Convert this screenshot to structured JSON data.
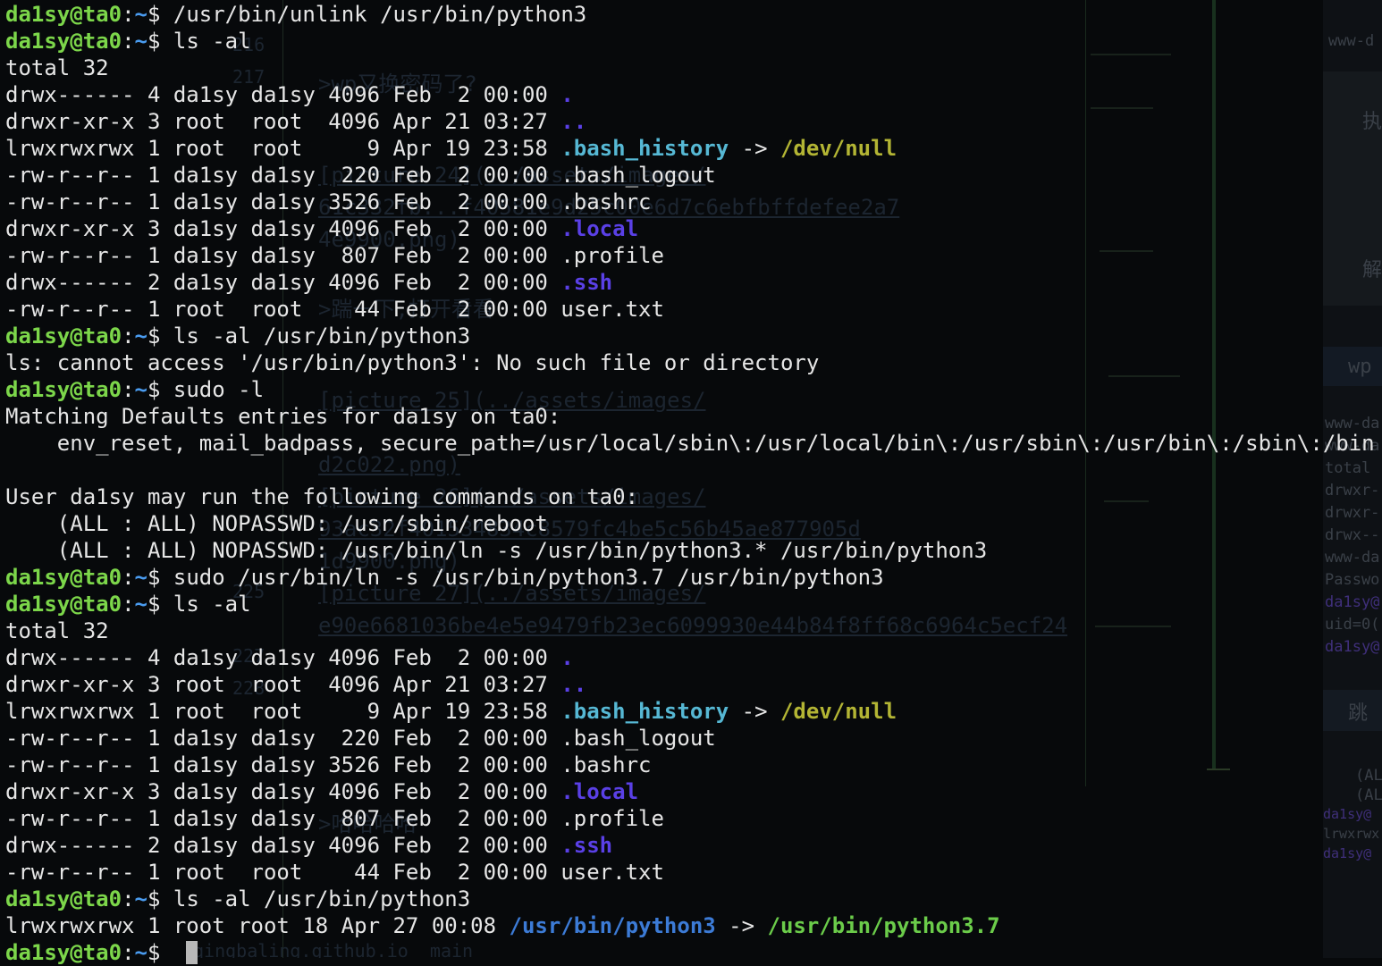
{
  "prompt": {
    "user": "da1sy",
    "at": "@",
    "host": "ta0",
    "colon": ":",
    "path": "~",
    "symbol": "$ "
  },
  "lines": [
    {
      "type": "prompt",
      "cmd": "/usr/bin/unlink /usr/bin/python3"
    },
    {
      "type": "prompt",
      "cmd": "ls -al"
    },
    {
      "type": "text",
      "text": "total 32"
    },
    {
      "type": "ls",
      "prefix": "drwx------ 4 da1sy da1sy 4096 Feb  2 00:00 ",
      "name": ".",
      "style": "dir"
    },
    {
      "type": "ls",
      "prefix": "drwxr-xr-x 3 root  root  4096 Apr 21 03:27 ",
      "name": "..",
      "style": "dir"
    },
    {
      "type": "ls",
      "prefix": "lrwxrwxrwx 1 root  root     9 Apr 19 23:58 ",
      "name": ".bash_history",
      "style": "cyan",
      "arrow": " -> ",
      "target": "/dev/null",
      "targetStyle": "yellow"
    },
    {
      "type": "ls",
      "prefix": "-rw-r--r-- 1 da1sy da1sy  220 Feb  2 00:00 ",
      "name": ".bash_logout",
      "style": "plain"
    },
    {
      "type": "ls",
      "prefix": "-rw-r--r-- 1 da1sy da1sy 3526 Feb  2 00:00 ",
      "name": ".bashrc",
      "style": "plain"
    },
    {
      "type": "ls",
      "prefix": "drwxr-xr-x 3 da1sy da1sy 4096 Feb  2 00:00 ",
      "name": ".local",
      "style": "dir"
    },
    {
      "type": "ls",
      "prefix": "-rw-r--r-- 1 da1sy da1sy  807 Feb  2 00:00 ",
      "name": ".profile",
      "style": "plain"
    },
    {
      "type": "ls",
      "prefix": "drwx------ 2 da1sy da1sy 4096 Feb  2 00:00 ",
      "name": ".ssh",
      "style": "dir"
    },
    {
      "type": "ls",
      "prefix": "-rw-r--r-- 1 root  root    44 Feb  2 00:00 ",
      "name": "user.txt",
      "style": "plain"
    },
    {
      "type": "prompt",
      "cmd": "ls -al /usr/bin/python3"
    },
    {
      "type": "text",
      "text": "ls: cannot access '/usr/bin/python3': No such file or directory"
    },
    {
      "type": "prompt",
      "cmd": "sudo -l"
    },
    {
      "type": "text",
      "text": "Matching Defaults entries for da1sy on ta0:"
    },
    {
      "type": "text",
      "text": "    env_reset, mail_badpass, secure_path=/usr/local/sbin\\:/usr/local/bin\\:/usr/sbin\\:/usr/bin\\:/sbin\\:/bin"
    },
    {
      "type": "text",
      "text": ""
    },
    {
      "type": "text",
      "text": "User da1sy may run the following commands on ta0:"
    },
    {
      "type": "text",
      "text": "    (ALL : ALL) NOPASSWD: /usr/sbin/reboot"
    },
    {
      "type": "text",
      "text": "    (ALL : ALL) NOPASSWD: /usr/bin/ln -s /usr/bin/python3.* /usr/bin/python3"
    },
    {
      "type": "prompt",
      "cmd": "sudo /usr/bin/ln -s /usr/bin/python3.7 /usr/bin/python3"
    },
    {
      "type": "prompt",
      "cmd": "ls -al"
    },
    {
      "type": "text",
      "text": "total 32"
    },
    {
      "type": "ls",
      "prefix": "drwx------ 4 da1sy da1sy 4096 Feb  2 00:00 ",
      "name": ".",
      "style": "dir"
    },
    {
      "type": "ls",
      "prefix": "drwxr-xr-x 3 root  root  4096 Apr 21 03:27 ",
      "name": "..",
      "style": "dir"
    },
    {
      "type": "ls",
      "prefix": "lrwxrwxrwx 1 root  root     9 Apr 19 23:58 ",
      "name": ".bash_history",
      "style": "cyan",
      "arrow": " -> ",
      "target": "/dev/null",
      "targetStyle": "yellow"
    },
    {
      "type": "ls",
      "prefix": "-rw-r--r-- 1 da1sy da1sy  220 Feb  2 00:00 ",
      "name": ".bash_logout",
      "style": "plain"
    },
    {
      "type": "ls",
      "prefix": "-rw-r--r-- 1 da1sy da1sy 3526 Feb  2 00:00 ",
      "name": ".bashrc",
      "style": "plain"
    },
    {
      "type": "ls",
      "prefix": "drwxr-xr-x 3 da1sy da1sy 4096 Feb  2 00:00 ",
      "name": ".local",
      "style": "dir"
    },
    {
      "type": "ls",
      "prefix": "-rw-r--r-- 1 da1sy da1sy  807 Feb  2 00:00 ",
      "name": ".profile",
      "style": "plain"
    },
    {
      "type": "ls",
      "prefix": "drwx------ 2 da1sy da1sy 4096 Feb  2 00:00 ",
      "name": ".ssh",
      "style": "dir"
    },
    {
      "type": "ls",
      "prefix": "-rw-r--r-- 1 root  root    44 Feb  2 00:00 ",
      "name": "user.txt",
      "style": "plain"
    },
    {
      "type": "prompt",
      "cmd": "ls -al /usr/bin/python3"
    },
    {
      "type": "ls",
      "prefix": "lrwxrwxrwx 1 root root 18 Apr 27 00:08 ",
      "name": "/usr/bin/python3",
      "style": "blue",
      "arrow": " -> ",
      "target": "/usr/bin/python3.7",
      "targetStyle": "green"
    },
    {
      "type": "prompt",
      "cmd": "",
      "cursor": true
    }
  ],
  "background": {
    "ghost_lines": [
      ">wp又换密码了?",
      "[picture 24](../assets/images/",
      "61c332fb...f40581e9d25c00e6d7c6ebfbffdefee2a7",
      "4e9900.png)",
      ">踹一下,打开看看",
      "[picture 25](../assets/images/",
      "d2c022.png)",
      "[picture 26](../assets/images/",
      "93ac32f401534834c8579fc4be5c56b45ae877905d",
      "1d9900.png)",
      "[picture 27](../assets/images/",
      "e90e6681036be4e5e9479fb23ec6099930e44b84f8ff68c6964c5ecf24",
      ">哈哈哈哈",
      "qingbaling.github.io  main"
    ],
    "line_numbers": [
      "216",
      "217",
      "225",
      "227",
      "228"
    ],
    "side_text": [
      "www-d",
      "执",
      "解",
      "wp",
      "跳",
      "www-da",
      "www-da",
      "total",
      "drwxr-",
      "drwxr-",
      "drwx--",
      "www-da",
      "Passwo",
      "da1sy@",
      "uid=0(",
      "da1sy@",
      "(AL",
      "(AL",
      "da1sy@",
      "lrwxrwx",
      "da1sy@"
    ]
  }
}
